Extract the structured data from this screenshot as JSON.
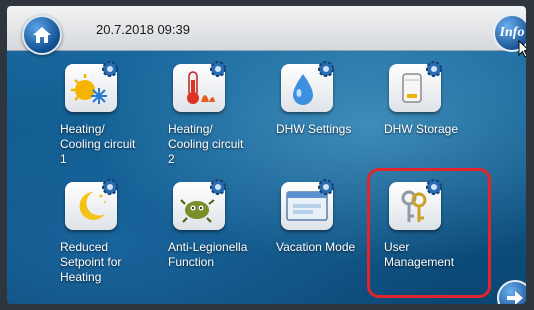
{
  "header": {
    "datetime": "20.7.2018 09:39",
    "home_icon": "home-icon",
    "info_label": "Info"
  },
  "tiles": [
    {
      "label": "Heating/\nCooling circuit\n1",
      "icon": "sun-snowflake-icon"
    },
    {
      "label": "Heating/\nCooling circuit\n2",
      "icon": "thermometer-icon"
    },
    {
      "label": "DHW Settings",
      "icon": "water-drop-icon"
    },
    {
      "label": "DHW Storage",
      "icon": "storage-tank-icon"
    },
    {
      "label": "Reduced\nSetpoint for\nHeating",
      "icon": "moon-icon"
    },
    {
      "label": "Anti-Legionella\nFunction",
      "icon": "bacteria-icon"
    },
    {
      "label": "Vacation Mode",
      "icon": "window-icon"
    },
    {
      "label": "User\nManagement",
      "icon": "keys-icon"
    }
  ],
  "colors": {
    "highlight": "#e2242c",
    "accent": "#1a5696"
  }
}
